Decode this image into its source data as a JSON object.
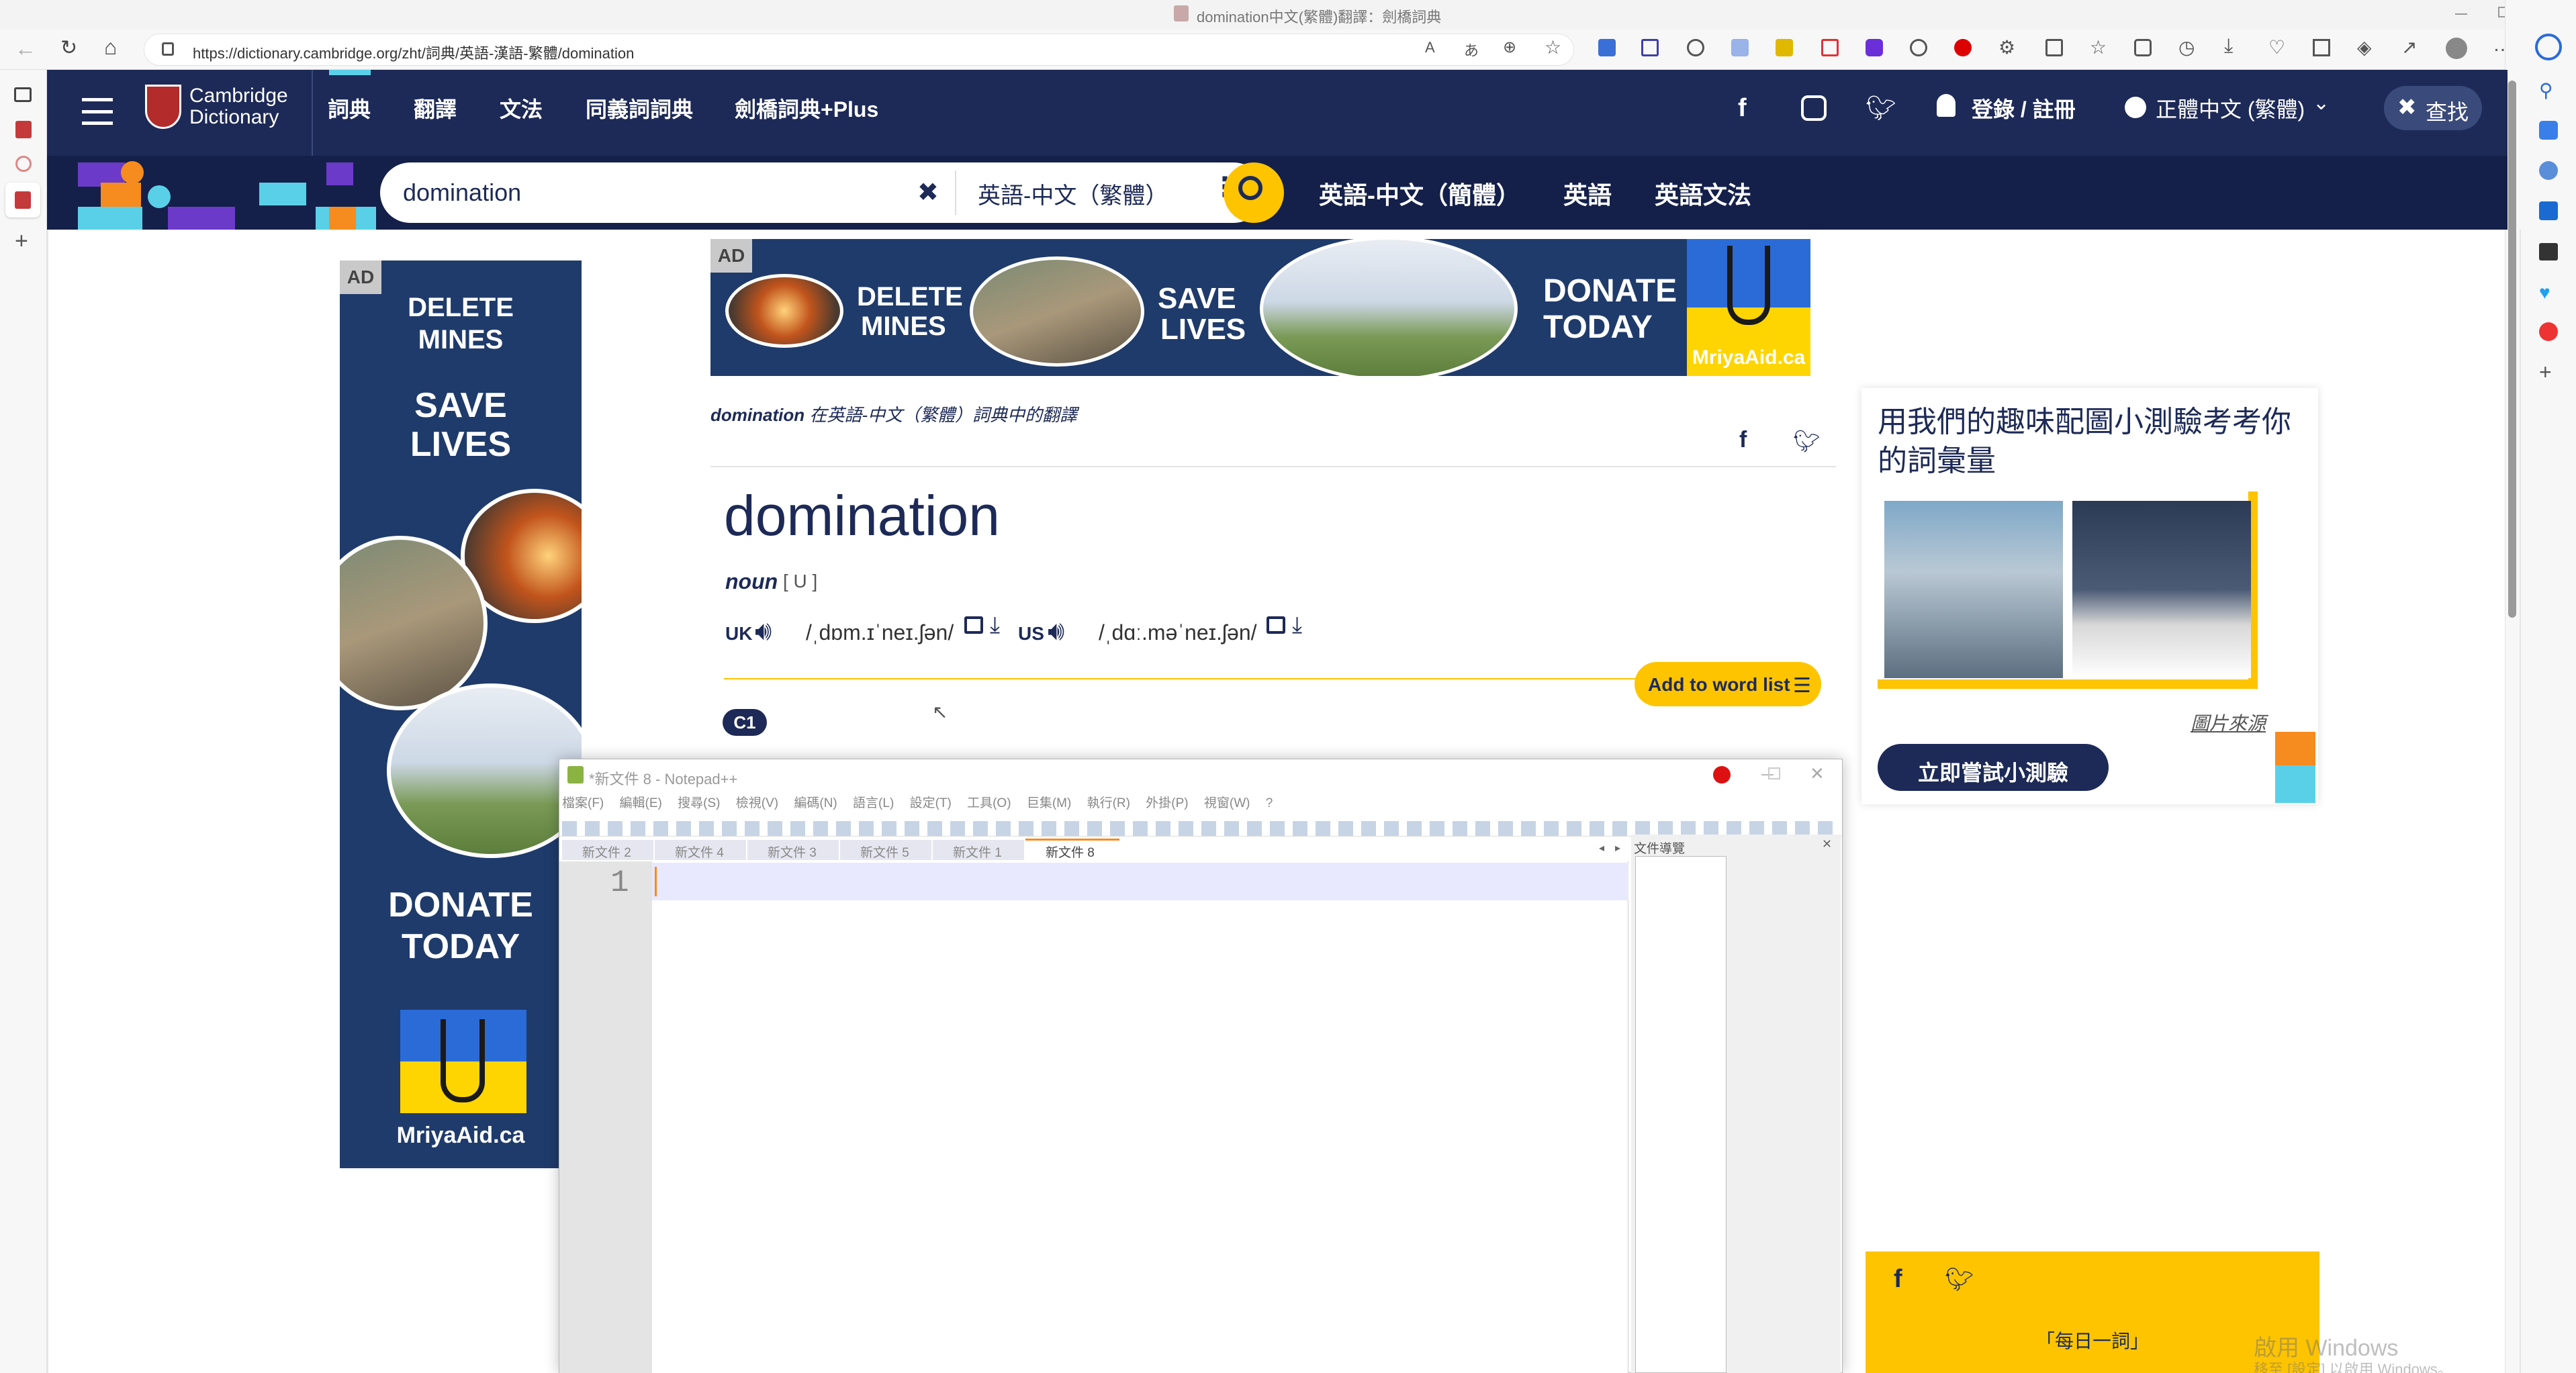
{
  "browser": {
    "window_title": "domination中文(繁體)翻譯：劍橋詞典",
    "url": "https://dictionary.cambridge.org/zht/詞典/英語-漢語-繁體/domination"
  },
  "site": {
    "logo_line1": "Cambridge",
    "logo_line2": "Dictionary",
    "nav": [
      "詞典",
      "翻譯",
      "文法",
      "同義詞詞典",
      "劍橋詞典+Plus"
    ],
    "login": "登錄 / 註冊",
    "language": "正體中文 (繁體)",
    "search_btn": "查找",
    "search_value": "domination",
    "dict_select": "英語-中文（繁體）",
    "quick_links": [
      "英語-中文（簡體）",
      "英語",
      "英語文法"
    ]
  },
  "ads": {
    "ad_label": "AD",
    "left": {
      "l1": "DELETE",
      "l2": "MINES",
      "l3": "SAVE",
      "l4": "LIVES",
      "l5": "DONATE",
      "l6": "TODAY",
      "brand": "MriyaAid.ca"
    },
    "top": {
      "a": "DELETE",
      "b": "MINES",
      "c": "SAVE",
      "d": "LIVES",
      "e": "DONATE",
      "f": "TODAY",
      "brand": "MriyaAid.ca"
    }
  },
  "entry": {
    "translation_word": "domination",
    "translation_rest": "在英語-中文（繁體）詞典中的翻譯",
    "headword": "domination",
    "pos": "noun",
    "gram": "[ U ]",
    "uk_label": "UK",
    "uk_ipa": "/ˌdɒm.ɪˈneɪ.ʃən/",
    "us_label": "US",
    "us_ipa": "/ˌdɑː.məˈneɪ.ʃən/",
    "add_to_list": "Add to word list",
    "level": "C1"
  },
  "quiz": {
    "title": "用我們的趣味配圖小測驗考考你的詞彙量",
    "credit": "圖片來源",
    "button": "立即嘗試小測驗"
  },
  "word_of_day": "「每日一詞」",
  "notepad": {
    "title": "*新文件 8 - Notepad++",
    "menu": [
      "檔案(F)",
      "編輯(E)",
      "搜尋(S)",
      "檢視(V)",
      "編碼(N)",
      "語言(L)",
      "設定(T)",
      "工具(O)",
      "巨集(M)",
      "執行(R)",
      "外掛(P)",
      "視窗(W)",
      "?"
    ],
    "tabs": [
      "新文件 2",
      "新文件 4",
      "新文件 3",
      "新文件 5",
      "新文件 1",
      "新文件 8"
    ],
    "line_number": "1",
    "panel_title": "文件導覽"
  },
  "watermark": {
    "line1": "啟用 Windows",
    "line2": "移至 [設定] 以啟用 Windows。"
  }
}
